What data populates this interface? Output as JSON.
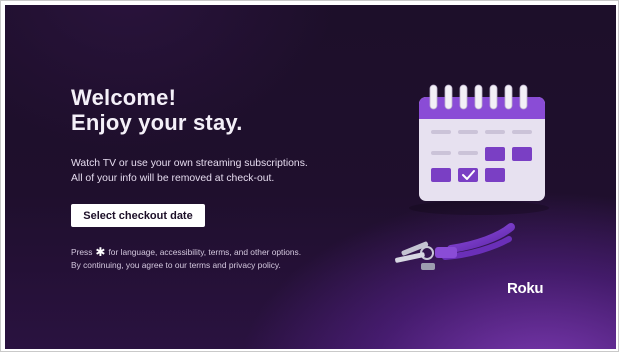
{
  "welcome": {
    "title_line1": "Welcome!",
    "title_line2": "Enjoy your stay.",
    "description_line1": "Watch TV or use your own streaming subscriptions.",
    "description_line2": "All of your info will be removed at check-out.",
    "button_label": "Select checkout date",
    "footnote_press": "Press",
    "footnote_options": "for language, accessibility, terms, and other options.",
    "footnote_line2": "By continuing, you agree to our terms and privacy policy."
  },
  "icons": {
    "options": "asterisk-icon",
    "illustration_calendar": "calendar-icon",
    "illustration_keys": "keys-icon"
  },
  "brand": {
    "logo_text": "Roku"
  },
  "colors": {
    "background": "#1f0f2d",
    "accent_purple": "#7a3fc4",
    "button_bg": "#ffffff",
    "text_primary": "#f4f0f8"
  }
}
